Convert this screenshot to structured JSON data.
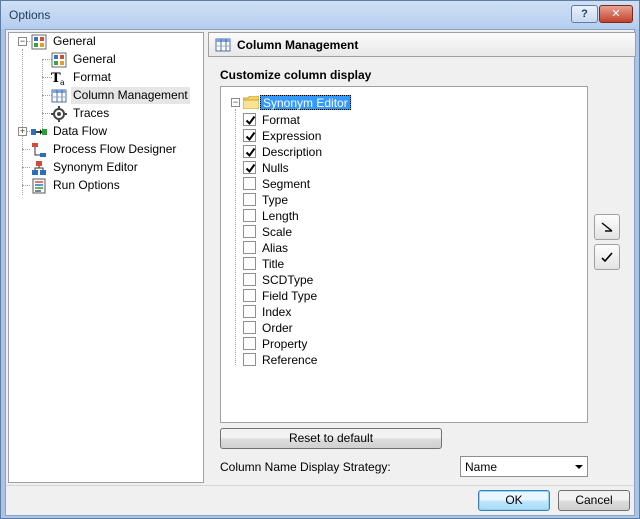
{
  "window": {
    "title": "Options",
    "help_label": "?",
    "close_label": "✕"
  },
  "left_tree": {
    "items": [
      {
        "label": "General",
        "icon": "general-settings-icon",
        "expander": "−"
      },
      {
        "label": "General",
        "icon": "general-settings-icon"
      },
      {
        "label": "Format",
        "icon": "format-text-icon"
      },
      {
        "label": "Column Management",
        "icon": "column-grid-icon",
        "selected": true
      },
      {
        "label": "Traces",
        "icon": "trace-gear-icon"
      },
      {
        "label": "Data Flow",
        "icon": "data-flow-icon",
        "expander": "+"
      },
      {
        "label": "Process Flow Designer",
        "icon": "process-flow-icon"
      },
      {
        "label": "Synonym Editor",
        "icon": "synonym-editor-icon"
      },
      {
        "label": "Run Options",
        "icon": "run-options-icon"
      }
    ]
  },
  "panel": {
    "title": "Column Management",
    "group_label": "Customize column display",
    "root": {
      "label": "Synonym Editor",
      "expander": "−"
    },
    "columns": [
      {
        "label": "Format",
        "checked": true
      },
      {
        "label": "Expression",
        "checked": true
      },
      {
        "label": "Description",
        "checked": true
      },
      {
        "label": "Nulls",
        "checked": true
      },
      {
        "label": "Segment",
        "checked": false
      },
      {
        "label": "Type",
        "checked": false
      },
      {
        "label": "Length",
        "checked": false
      },
      {
        "label": "Scale",
        "checked": false
      },
      {
        "label": "Alias",
        "checked": false
      },
      {
        "label": "Title",
        "checked": false
      },
      {
        "label": "SCDType",
        "checked": false
      },
      {
        "label": "Field Type",
        "checked": false
      },
      {
        "label": "Index",
        "checked": false
      },
      {
        "label": "Order",
        "checked": false
      },
      {
        "label": "Property",
        "checked": false
      },
      {
        "label": "Reference",
        "checked": false
      }
    ],
    "reset_label": "Reset to default",
    "strategy_label": "Column Name Display Strategy:",
    "strategy_value": "Name"
  },
  "footer": {
    "ok_label": "OK",
    "cancel_label": "Cancel"
  },
  "colors": {
    "selection": "#3399ff",
    "default_button": "#bee6fd",
    "titlebar": "#b5cdee"
  }
}
